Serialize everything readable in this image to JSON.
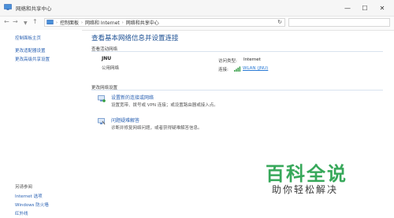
{
  "window": {
    "title": "网络和共享中心",
    "controls": [
      "—",
      "☐",
      "✕"
    ]
  },
  "address": {
    "crumbs": [
      "控制面板",
      "网络和 Internet",
      "网络和共享中心"
    ]
  },
  "sidebar": {
    "top_links": [
      "控制面板主页",
      "更改适配器设置",
      "更改高级共享设置"
    ],
    "see_also_title": "另请参阅",
    "see_also_links": [
      "Internet 选项",
      "Windows 防火墙",
      "红外线"
    ]
  },
  "main": {
    "title": "查看基本网络信息并设置连接",
    "active_networks_label": "查看活动网络",
    "network": {
      "name": "JNU",
      "type": "公用网络",
      "access_type_label": "访问类型:",
      "access_type_value": "Internet",
      "connections_label": "连接:",
      "connection_value": "WLAN (JNU)"
    },
    "change_settings_label": "更改网络设置",
    "tasks": [
      {
        "title": "设置新的连接或网络",
        "desc": "设置宽带、拨号或 VPN 连接；或设置路由器或接入点。"
      },
      {
        "title": "问题疑难解答",
        "desc": "诊断并修复网络问题，或者获得疑难解答信息。"
      }
    ]
  },
  "watermark": {
    "title": "百科全说",
    "subtitle": "助你轻松解决"
  },
  "colors": {
    "link": "#2b62b3",
    "title": "#1b4f93",
    "watermark_green": "#37a85a"
  }
}
